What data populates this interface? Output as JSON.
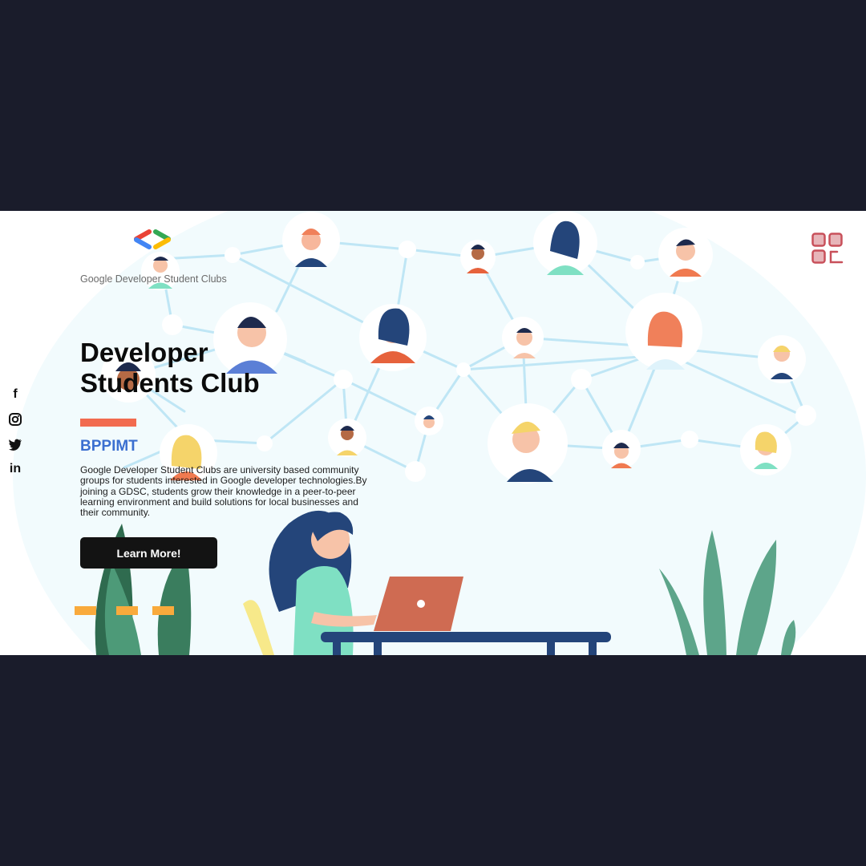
{
  "logo": {
    "text": "Google Developer Student Clubs",
    "icon": "gdsc-brackets-icon"
  },
  "menu": {
    "icon": "grid-menu-icon",
    "color": "#c8505a"
  },
  "social": [
    {
      "name": "facebook",
      "glyph": "f"
    },
    {
      "name": "instagram",
      "glyph": ""
    },
    {
      "name": "twitter",
      "glyph": ""
    },
    {
      "name": "linkedin",
      "glyph": "in"
    }
  ],
  "hero": {
    "title_line1": "Developer",
    "title_line2": "Students Club",
    "org": "BPPIMT",
    "description": "Google Developer Student Clubs are university based community groups for students interested in Google developer technologies.By joining a GDSC, students grow their knowledge in a peer-to-peer learning environment and build solutions for local businesses and their community.",
    "cta_label": "Learn More!"
  },
  "colors": {
    "accent_bar": "#f26b4f",
    "org_text": "#3b6fd0",
    "button": "#131313",
    "dashes": "#f9aa3c",
    "network_lines": "#bfe6f5",
    "backdrop": "#1a1c2b"
  }
}
